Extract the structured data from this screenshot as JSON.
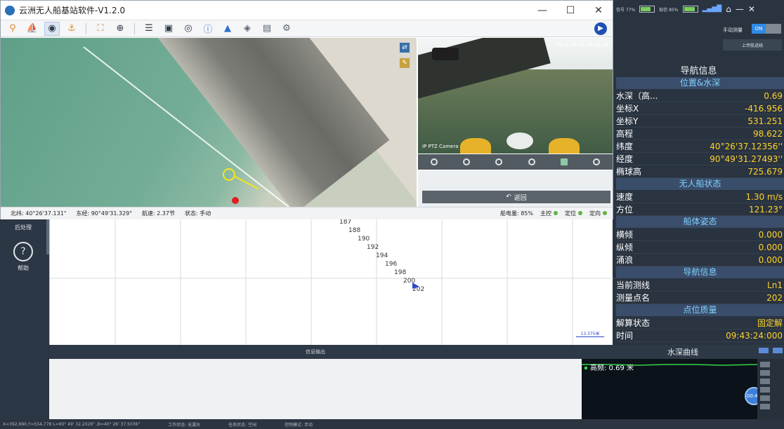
{
  "window": {
    "title": "云洲无人船基站软件-V1.2.0",
    "controls": [
      "—",
      "☐",
      "✕"
    ]
  },
  "toolbar": {
    "icons": [
      "marker-icon",
      "boat-icon",
      "remote-control-icon",
      "anchor-icon",
      "expand-icon",
      "target-icon",
      "list-icon",
      "monitor-icon",
      "camera-icon",
      "info-icon",
      "navigation-icon",
      "waypoint-icon",
      "record-icon",
      "settings-icon",
      "next-icon"
    ]
  },
  "camera": {
    "label": "IP PTZ Camera",
    "timestamp": "2019-08-01 09:43:24",
    "back_label": "返回"
  },
  "status_bar": {
    "latitude": "北纬: 40°26'37.131\"",
    "longitude": "东经: 90°49'31.329\"",
    "speed": "航速: 2.37节",
    "state": "状态: 手动",
    "battery": "船电量: 85%",
    "main_control": "主控",
    "positioning": "定位",
    "heading": "定向"
  },
  "left_nav": {
    "post_process": "后处理",
    "help": "帮助"
  },
  "plot": {
    "track_labels": [
      "187",
      "188",
      "190",
      "192",
      "194",
      "196",
      "198",
      "200",
      "202"
    ],
    "scale_label": "13.375米"
  },
  "output": {
    "title": "信息输出"
  },
  "depth_curve": {
    "title": "水深曲线",
    "readout": "高频: 0.69 米",
    "timer": "00:47"
  },
  "bottom_status": {
    "coords": "X=392,990,Y=554,778  L=90° 49' 32.2026\" ,B=40° 26' 37.5036\"",
    "work_state": "工作状态: 无漏水",
    "task_state": "任务状态: 空闲",
    "control_mode": "控制模式: 手动"
  },
  "right_panel": {
    "signal_left": "信号 77%",
    "battery_left_pct": 0.77,
    "signal_mid": "船信 85%",
    "battery_mid_pct": 0.85,
    "manual_label": "手动测量",
    "toggle_label": "ON",
    "upload_label": "上传航迹线",
    "nav_title": "导航信息",
    "sections": [
      {
        "title": "位置&水深",
        "rows": [
          {
            "label": "水深（高...",
            "value": "0.69"
          },
          {
            "label": "坐标X",
            "value": "-416.956"
          },
          {
            "label": "坐标Y",
            "value": "531.251"
          },
          {
            "label": "高程",
            "value": "98.622"
          },
          {
            "label": "纬度",
            "value": "40°26'37.12356''"
          },
          {
            "label": "经度",
            "value": "90°49'31.27493''"
          },
          {
            "label": "椭球高",
            "value": "725.679"
          }
        ]
      },
      {
        "title": "无人船状态",
        "rows": [
          {
            "label": "速度",
            "value": "1.30 m/s"
          },
          {
            "label": "方位",
            "value": "121.23°"
          }
        ]
      },
      {
        "title": "船体姿态",
        "rows": [
          {
            "label": "横倾",
            "value": "0.000"
          },
          {
            "label": "纵倾",
            "value": "0.000"
          },
          {
            "label": "涌浪",
            "value": "0.000"
          }
        ]
      },
      {
        "title": "导航信息",
        "rows": [
          {
            "label": "当前测线",
            "value": "Ln1"
          },
          {
            "label": "测量点名",
            "value": "202"
          }
        ]
      },
      {
        "title": "点位质量",
        "rows": [
          {
            "label": "解算状态",
            "value": "固定解"
          },
          {
            "label": "时间",
            "value": "09:43:24:000"
          }
        ]
      }
    ]
  },
  "colors": {
    "accent_value": "#ffd32a",
    "section_title": "#7fd0ff",
    "toggle_on": "#2e8ae6"
  }
}
